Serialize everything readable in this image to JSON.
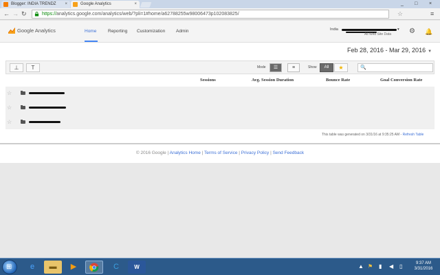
{
  "browser": {
    "tabs": [
      {
        "label": "Blogger: INDIA TRENDZ",
        "favicon": "blogger-icon"
      },
      {
        "label": "Google Analytics",
        "favicon": "analytics-icon"
      }
    ],
    "tab_close": "×",
    "window_controls": [
      "_",
      "□",
      "×"
    ],
    "url_scheme": "https://",
    "url_rest": "analytics.google.com/analytics/web/?pli=1#home/a62788255w98006473p102083825/"
  },
  "ga": {
    "product_name": "Google Analytics",
    "nav": [
      "Home",
      "Reporting",
      "Customization",
      "Admin"
    ],
    "active_nav": "Home",
    "account_prefix": "India",
    "account_suffix": "All Web Site Data"
  },
  "content": {
    "date_range": "Feb 28, 2016 - Mar 29, 2016",
    "toolbar": {
      "mode_label": "Mode",
      "show_label": "Show",
      "all_label": "All"
    },
    "columns": [
      "Sessions",
      "Avg. Session Duration",
      "Bounce Rate",
      "Goal Conversion Rate"
    ],
    "rows": [
      {
        "starred": false
      },
      {
        "starred": false
      },
      {
        "starred": false
      }
    ],
    "generated_note": "This table was generated on 3/31/16 at 9:35:25 AM -",
    "refresh_link": "Refresh Table"
  },
  "footer": {
    "copyright": "© 2016 Google",
    "links": [
      "Analytics Home",
      "Terms of Service",
      "Privacy Policy",
      "Send Feedback"
    ],
    "separator": "|"
  },
  "taskbar": {
    "pinned": [
      "ie-icon",
      "explorer-icon",
      "media-player-icon",
      "chrome-icon",
      "app-icon",
      "word-icon"
    ],
    "time": "9:37 AM",
    "date": "3/31/2016"
  },
  "colors": {
    "accent": "#4285f4",
    "link": "#3b6fd6",
    "taskbar": "#2c5a8a"
  }
}
